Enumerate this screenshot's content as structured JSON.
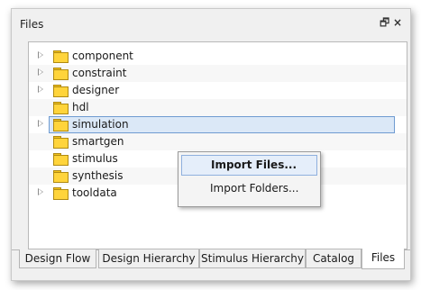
{
  "panel": {
    "title": "Files",
    "restore_glyph": "🗗",
    "close_glyph": "×"
  },
  "tree": {
    "items": [
      {
        "label": "component",
        "expandable": true
      },
      {
        "label": "constraint",
        "expandable": true
      },
      {
        "label": "designer",
        "expandable": true
      },
      {
        "label": "hdl",
        "expandable": false
      },
      {
        "label": "simulation",
        "expandable": true,
        "selected": true
      },
      {
        "label": "smartgen",
        "expandable": false
      },
      {
        "label": "stimulus",
        "expandable": false
      },
      {
        "label": "synthesis",
        "expandable": false
      },
      {
        "label": "tooldata",
        "expandable": true
      }
    ]
  },
  "context_menu": {
    "items": [
      {
        "label": "Import Files...",
        "default": true
      },
      {
        "label": "Import Folders..."
      }
    ]
  },
  "tabs": [
    {
      "label": "Design Flow"
    },
    {
      "label": "Design Hierarchy"
    },
    {
      "label": "Stimulus Hierarchy"
    },
    {
      "label": "Catalog"
    },
    {
      "label": "Files",
      "active": true
    }
  ],
  "colors": {
    "folder": "#ffd43b",
    "selection": "#dbe8f7",
    "selection_border": "#6f9bd1"
  }
}
